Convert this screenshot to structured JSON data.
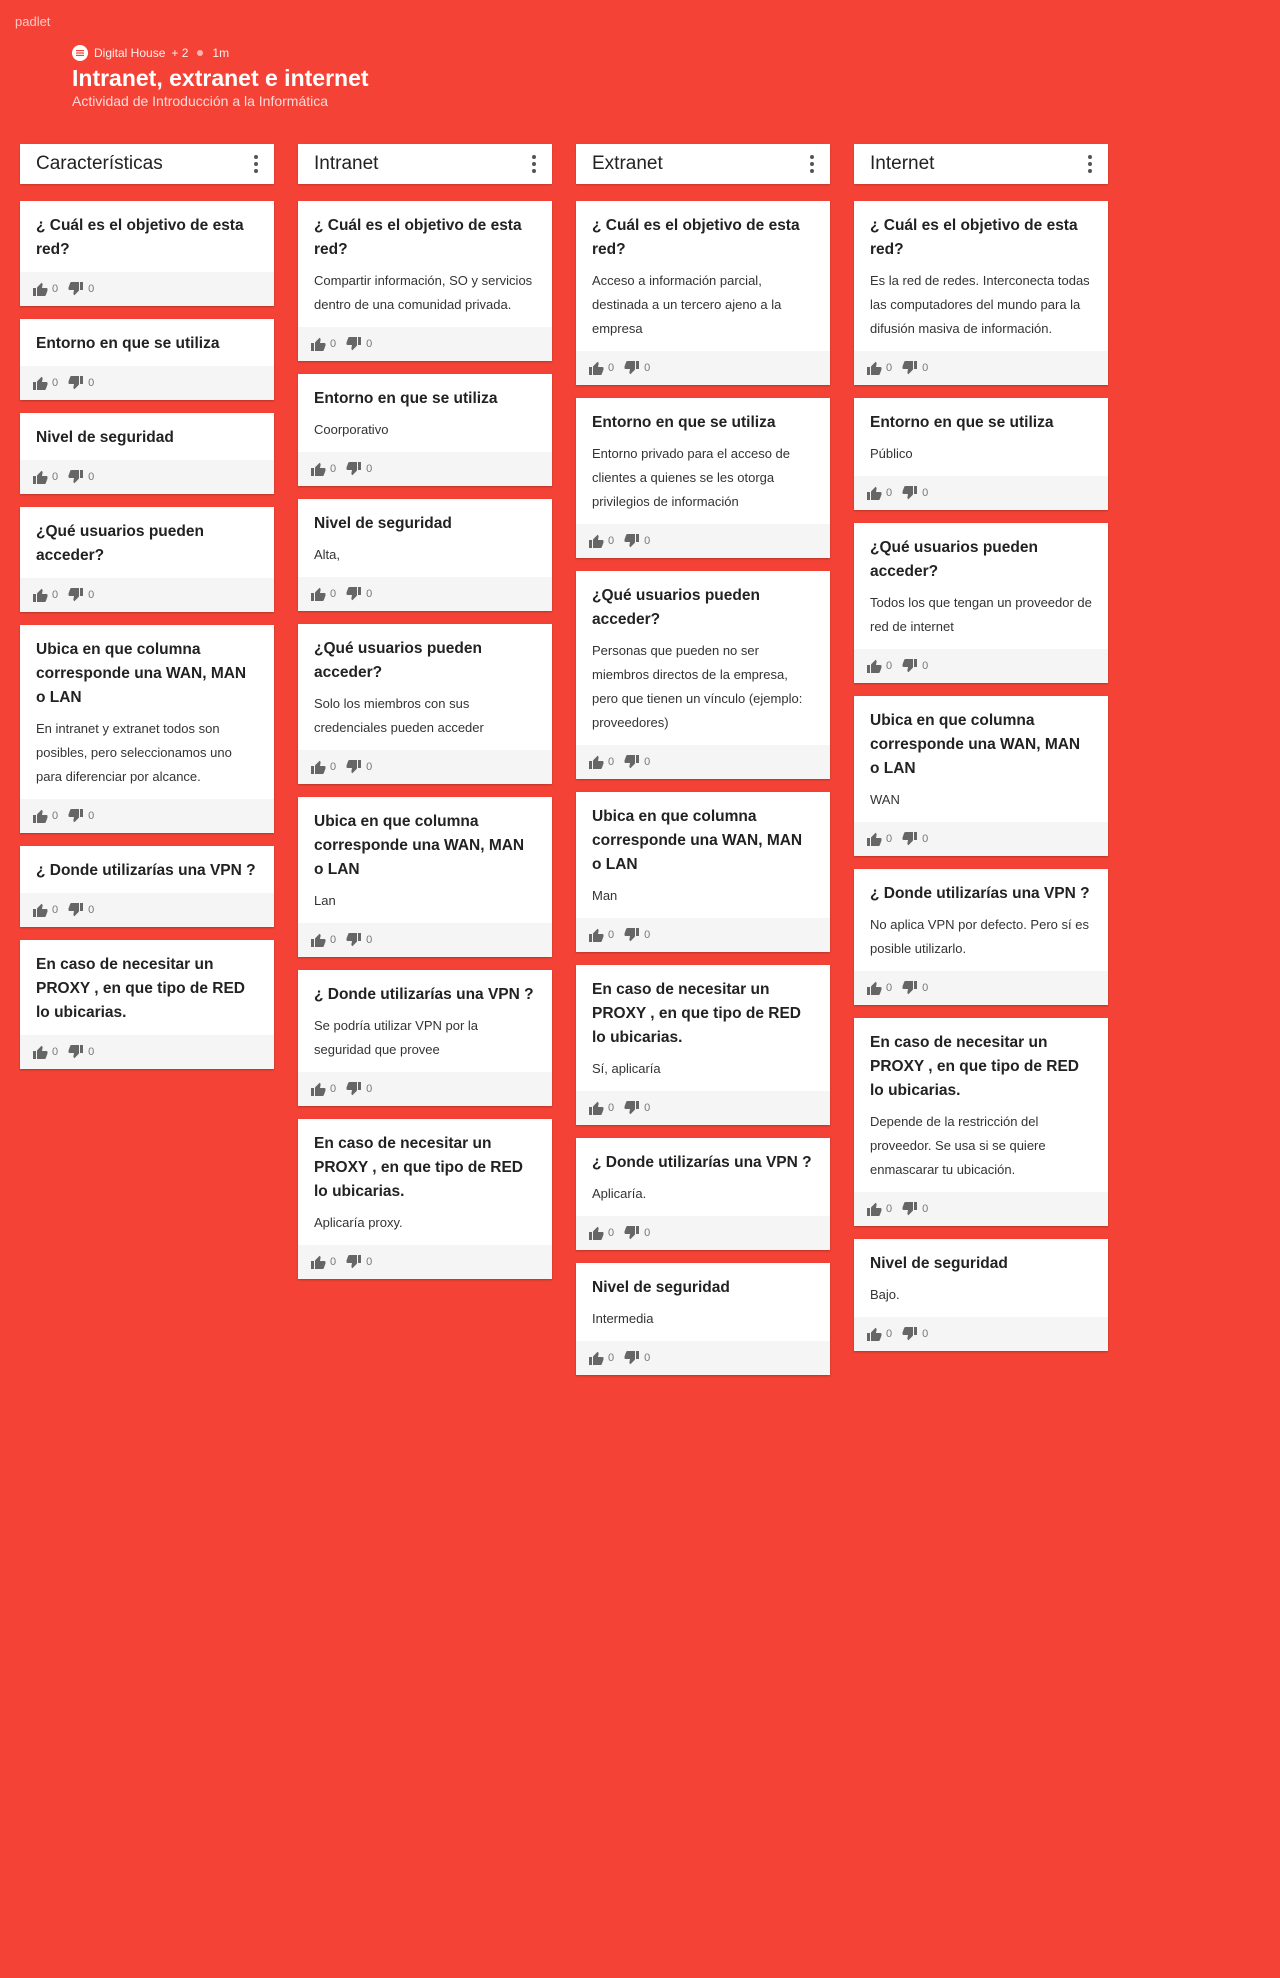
{
  "brand": "padlet",
  "header": {
    "author": "Digital House",
    "contributors": "+ 2",
    "time": "1m",
    "title": "Intranet, extranet e internet",
    "subtitle": "Actividad de Introducción a la Informática"
  },
  "columns": [
    {
      "title": "Características",
      "cards": [
        {
          "title": "¿ Cuál es el objetivo de esta red?",
          "text": "",
          "up": "0",
          "down": "0"
        },
        {
          "title": "Entorno en que se utiliza",
          "text": "",
          "up": "0",
          "down": "0"
        },
        {
          "title": "Nivel de seguridad",
          "text": "",
          "up": "0",
          "down": "0"
        },
        {
          "title": "¿Qué usuarios pueden acceder?",
          "text": "",
          "up": "0",
          "down": "0"
        },
        {
          "title": "Ubica en que columna corresponde una WAN, MAN o LAN",
          "text": "En intranet y extranet todos son posibles, pero seleccionamos uno para diferenciar por alcance.",
          "up": "0",
          "down": "0"
        },
        {
          "title": "¿ Donde utilizarías una VPN ?",
          "text": "",
          "up": "0",
          "down": "0"
        },
        {
          "title": "En caso de necesitar un PROXY , en que tipo de RED lo ubicarias.",
          "text": "",
          "up": "0",
          "down": "0"
        }
      ]
    },
    {
      "title": "Intranet",
      "cards": [
        {
          "title": "¿ Cuál es el objetivo de esta red?",
          "text": "Compartir  información, SO y servicios dentro de una comunidad privada.",
          "up": "0",
          "down": "0"
        },
        {
          "title": "Entorno en que se utiliza",
          "text": "Coorporativo",
          "up": "0",
          "down": "0"
        },
        {
          "title": "Nivel de seguridad",
          "text": "Alta,",
          "up": "0",
          "down": "0"
        },
        {
          "title": "¿Qué usuarios pueden acceder?",
          "text": "Solo los miembros con sus credenciales pueden acceder",
          "up": "0",
          "down": "0"
        },
        {
          "title": "Ubica en que columna corresponde una WAN, MAN o LAN",
          "text": "Lan",
          "up": "0",
          "down": "0"
        },
        {
          "title": "¿ Donde utilizarías una VPN ?",
          "text": "Se podría utilizar VPN por la seguridad que provee",
          "up": "0",
          "down": "0"
        },
        {
          "title": "En caso de necesitar un PROXY , en que tipo de RED lo ubicarias.",
          "text": "Aplicaría proxy.",
          "up": "0",
          "down": "0"
        }
      ]
    },
    {
      "title": "Extranet",
      "cards": [
        {
          "title": "¿ Cuál es el objetivo de esta red?",
          "text": "Acceso a información parcial, destinada a un tercero ajeno a la empresa",
          "up": "0",
          "down": "0"
        },
        {
          "title": "Entorno en que se utiliza",
          "text": "Entorno privado para el acceso de clientes a quienes se les otorga privilegios de información",
          "up": "0",
          "down": "0"
        },
        {
          "title": "¿Qué usuarios pueden acceder?",
          "text": "Personas que pueden no ser miembros directos de la empresa, pero que tienen un vínculo (ejemplo: proveedores)",
          "up": "0",
          "down": "0"
        },
        {
          "title": "Ubica en que columna corresponde una WAN, MAN o LAN",
          "text": "Man",
          "up": "0",
          "down": "0"
        },
        {
          "title": "En caso de necesitar un PROXY , en que tipo de RED lo ubicarias.",
          "text": "Sí, aplicaría",
          "up": "0",
          "down": "0"
        },
        {
          "title": "¿ Donde utilizarías una VPN ?",
          "text": "Aplicaría.",
          "up": "0",
          "down": "0"
        },
        {
          "title": "Nivel de seguridad",
          "text": "Intermedia",
          "up": "0",
          "down": "0"
        }
      ]
    },
    {
      "title": "Internet",
      "cards": [
        {
          "title": "¿ Cuál es el objetivo de esta red?",
          "text": "Es la red de redes. Interconecta todas las computadores del mundo para la difusión masiva de información.",
          "up": "0",
          "down": "0"
        },
        {
          "title": "Entorno en que se utiliza",
          "text": "Público",
          "up": "0",
          "down": "0"
        },
        {
          "title": "¿Qué usuarios pueden acceder?",
          "text": "Todos los que tengan un proveedor de red de internet",
          "up": "0",
          "down": "0"
        },
        {
          "title": "Ubica en que columna corresponde una WAN, MAN o LAN",
          "text": "WAN",
          "up": "0",
          "down": "0"
        },
        {
          "title": "¿ Donde utilizarías una VPN ?",
          "text": "No aplica VPN por defecto. Pero sí es posible utilizarlo.",
          "up": "0",
          "down": "0"
        },
        {
          "title": "En caso de necesitar un PROXY , en que tipo de RED lo ubicarias.",
          "text": "Depende de la restricción del proveedor. Se usa si se quiere enmascarar tu ubicación.",
          "up": "0",
          "down": "0"
        },
        {
          "title": "Nivel de seguridad",
          "text": "Bajo.",
          "up": "0",
          "down": "0"
        }
      ]
    }
  ]
}
